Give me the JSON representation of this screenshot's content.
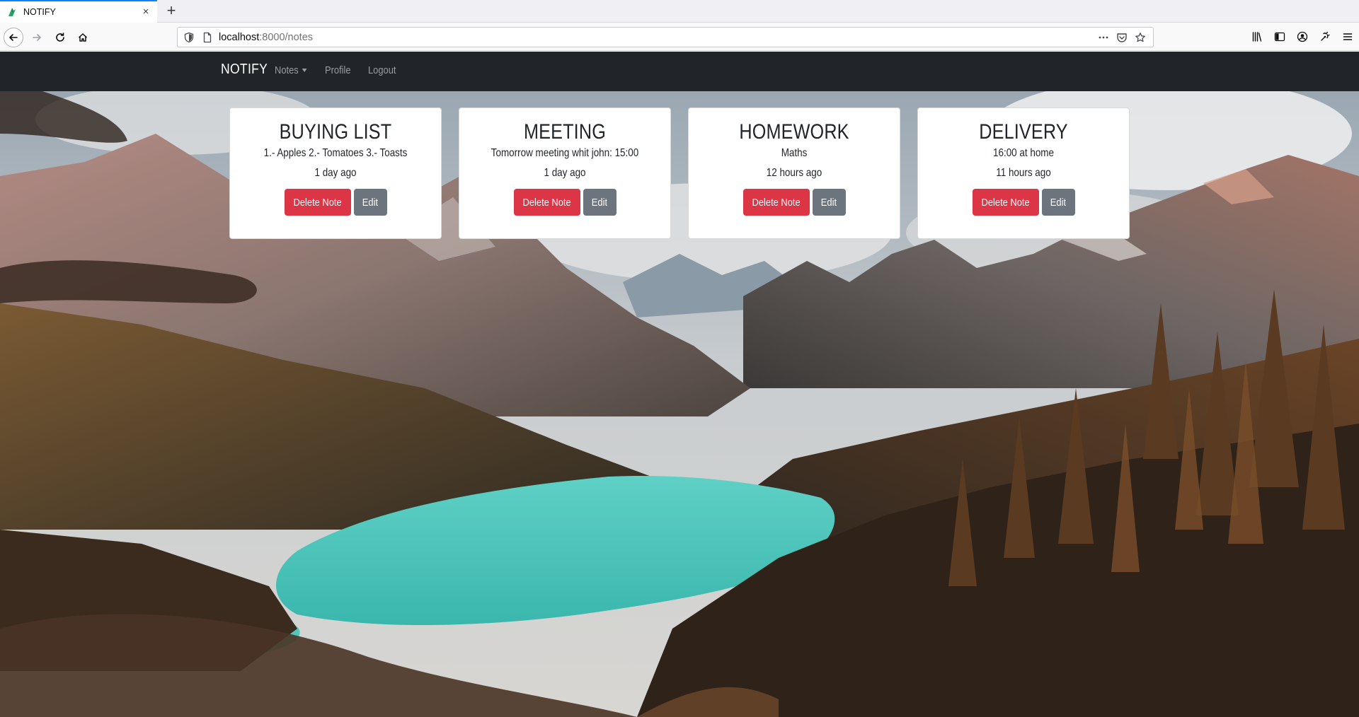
{
  "browser": {
    "tab_title": "NOTIFY",
    "new_tab_glyph": "+",
    "close_glyph": "×",
    "url_host": "localhost",
    "url_path": ":8000/notes",
    "icons": [
      "back-icon",
      "forward-icon",
      "reload-icon",
      "home-icon",
      "shield-icon",
      "page-icon",
      "more-icon",
      "pocket-icon",
      "bookmark-star-icon",
      "library-icon",
      "sidebar-icon",
      "account-icon",
      "extension-icon",
      "menu-icon"
    ]
  },
  "site": {
    "brand": "NOTIFY",
    "nav": {
      "notes": "Notes",
      "profile": "Profile",
      "logout": "Logout"
    },
    "colors": {
      "navbar": "#212529",
      "danger": "#dc3545",
      "secondary": "#6c757d"
    }
  },
  "notes": [
    {
      "title": "BUYING LIST",
      "text": "1.- Apples 2.- Tomatoes 3.- Toasts",
      "time": "1 day ago",
      "delete_label": "Delete Note",
      "edit_label": "Edit"
    },
    {
      "title": "MEETING",
      "text": "Tomorrow meeting whit john: 15:00",
      "time": "1 day ago",
      "delete_label": "Delete Note",
      "edit_label": "Edit"
    },
    {
      "title": "HOMEWORK",
      "text": "Maths",
      "time": "12 hours ago",
      "delete_label": "Delete Note",
      "edit_label": "Edit"
    },
    {
      "title": "DELIVERY",
      "text": "16:00 at home",
      "time": "11 hours ago",
      "delete_label": "Delete Note",
      "edit_label": "Edit"
    }
  ]
}
